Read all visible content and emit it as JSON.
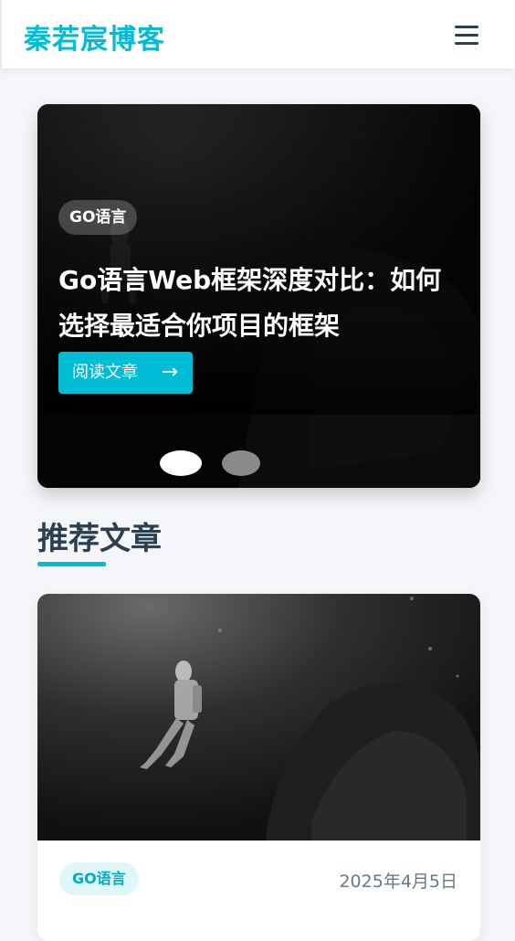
{
  "header": {
    "site_title": "秦若宸博客",
    "menu_icon": "hamburger-menu-icon"
  },
  "hero": {
    "tag": "GO语言",
    "title": "Go语言Web框架深度对比：如何选择最适合你项目的框架",
    "read_button_label": "阅读文章",
    "read_button_icon": "arrow-right-icon",
    "arrow_glyph": "→",
    "slides": {
      "total": 2,
      "active": 1
    }
  },
  "section": {
    "title": "推荐文章"
  },
  "articles": [
    {
      "tag": "GO语言",
      "date": "2025年4月5日",
      "image": "scuba-diver-photo"
    }
  ],
  "colors": {
    "accent": "#00bcd4",
    "text_dark": "#2c3e50",
    "tag_bg": "#e0f7fa",
    "page_bg": "#f4f6f9"
  }
}
